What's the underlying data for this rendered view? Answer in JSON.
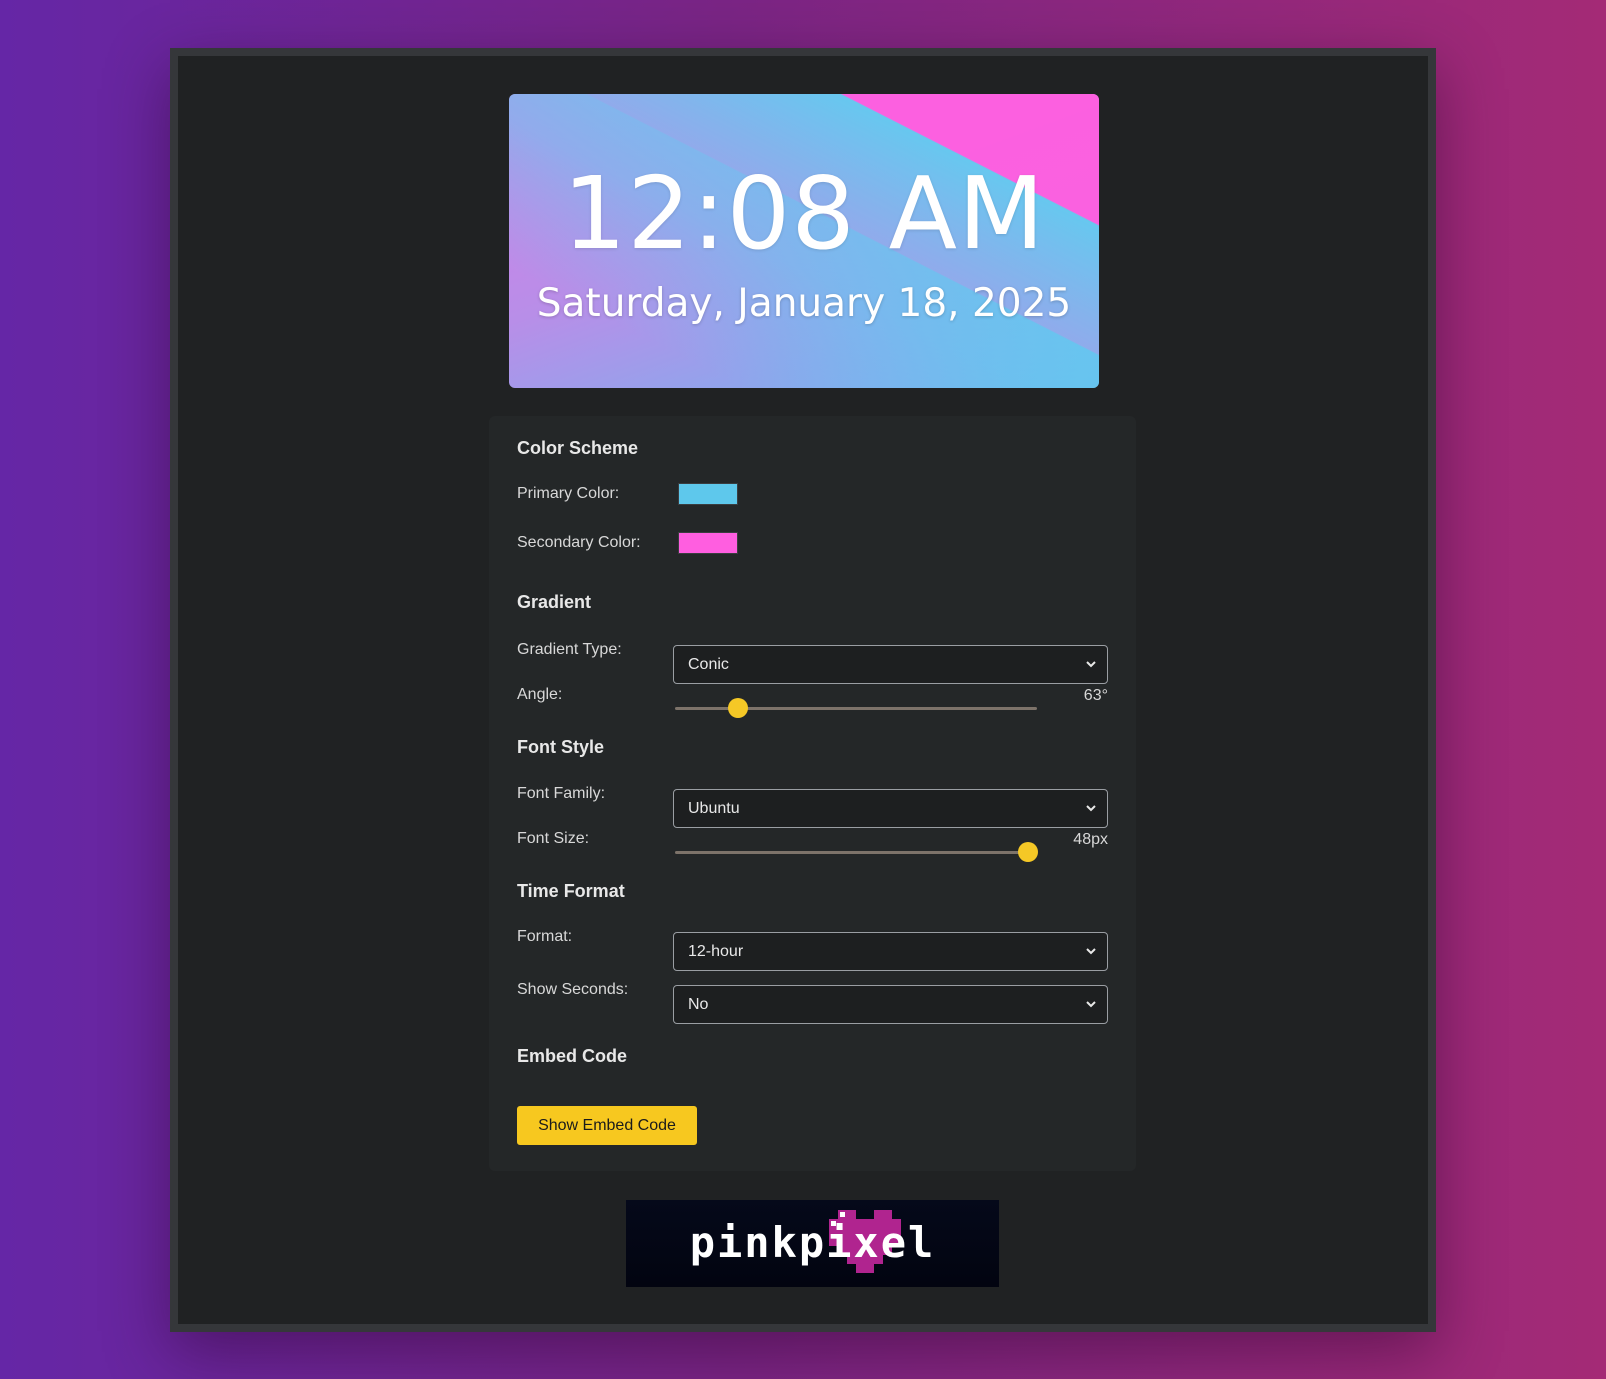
{
  "clock": {
    "time": "12:08 AM",
    "date": "Saturday, January 18, 2025"
  },
  "settings": {
    "color_scheme": {
      "title": "Color Scheme",
      "primary_label": "Primary Color:",
      "primary_color": "#5ec8ec",
      "secondary_label": "Secondary Color:",
      "secondary_color": "#ff5ee0"
    },
    "gradient": {
      "title": "Gradient",
      "type_label": "Gradient Type:",
      "type_value": "Conic",
      "angle_label": "Angle:",
      "angle_value": "63°",
      "angle_fraction": 0.175
    },
    "font_style": {
      "title": "Font Style",
      "family_label": "Font Family:",
      "family_value": "Ubuntu",
      "size_label": "Font Size:",
      "size_value": "48px",
      "size_fraction": 0.975
    },
    "time_format": {
      "title": "Time Format",
      "format_label": "Format:",
      "format_value": "12-hour",
      "seconds_label": "Show Seconds:",
      "seconds_value": "No"
    },
    "embed": {
      "title": "Embed Code",
      "button_label": "Show Embed Code"
    }
  },
  "logo": {
    "text": "pinkpixel",
    "accent_color": "#b0248f"
  }
}
